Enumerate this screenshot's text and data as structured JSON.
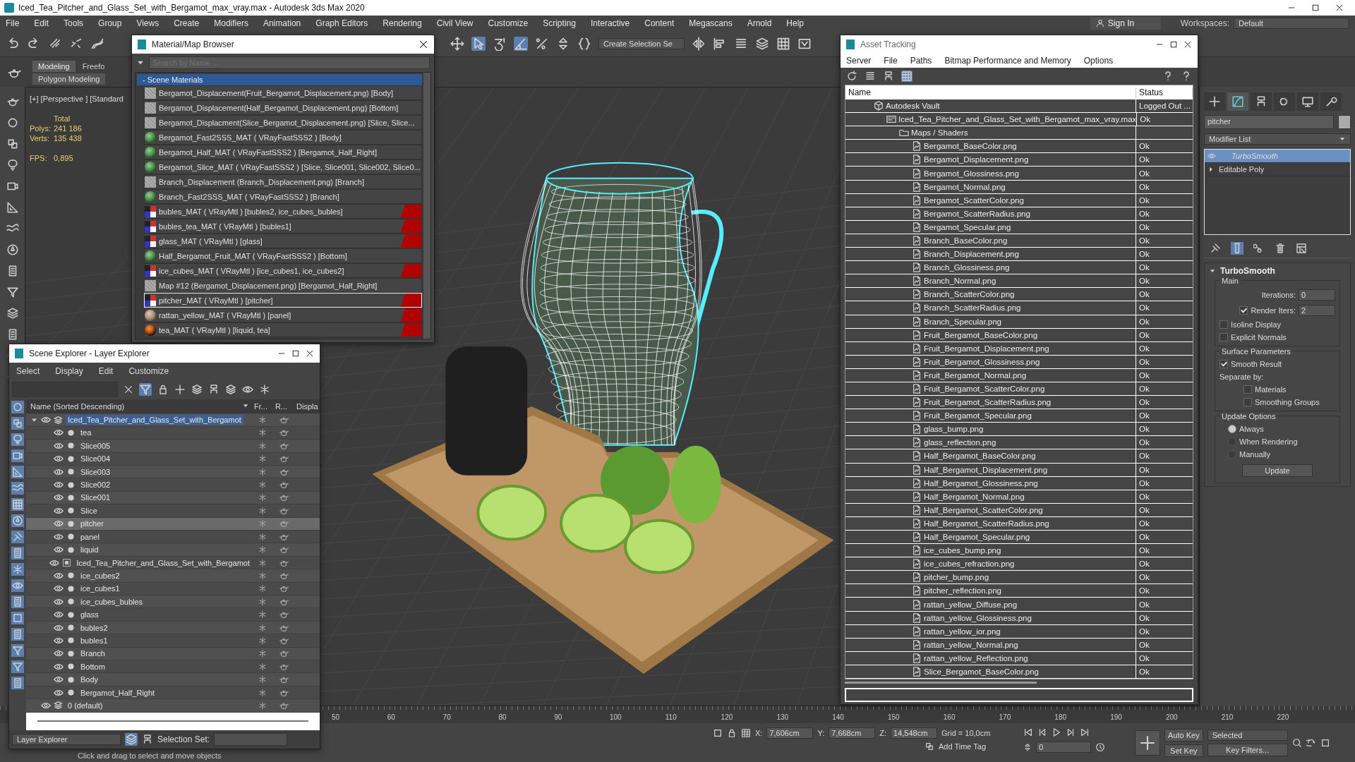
{
  "title": "Iced_Tea_Pitcher_and_Glass_Set_with_Bergamot_max_vray.max - Autodesk 3ds Max 2020",
  "menu": [
    "File",
    "Edit",
    "Tools",
    "Group",
    "Views",
    "Create",
    "Modifiers",
    "Animation",
    "Graph Editors",
    "Rendering",
    "Civil View",
    "Customize",
    "Scripting",
    "Interactive",
    "Content",
    "Megascans",
    "Arnold",
    "Help"
  ],
  "sign_in": "Sign In",
  "workspaces_label": "Workspaces:",
  "workspace": "Default",
  "selection_set_dropdown": "Create Selection Se",
  "ribbon": {
    "tabs": [
      {
        "label": "Modeling",
        "selected": true
      },
      {
        "label": "Freefo",
        "selected": false
      }
    ],
    "panel": "Polygon Modeling"
  },
  "viewport": {
    "label": "[+] [Perspective ] [Standard",
    "stats_header": "Total",
    "stats": [
      {
        "label": "Polys:",
        "value": "241 186"
      },
      {
        "label": "Verts:",
        "value": "135 438"
      }
    ],
    "fps_label": "FPS:",
    "fps": "0,895"
  },
  "material_browser": {
    "title": "Material/Map Browser",
    "search_placeholder": "Search by Name ...",
    "group": "- Scene Materials",
    "items": [
      {
        "text": "Bergamot_Displacement(Fruit_Bergamot_Displacement.png) [Body]",
        "kind": "map",
        "flagged": false,
        "selected": false
      },
      {
        "text": "Bergamot_Displacement(Half_Bergamot_Displacement.png) [Bottom]",
        "kind": "map",
        "flagged": false,
        "selected": false
      },
      {
        "text": "Bergamot_Displacment(Slice_Bergamot_Displacement.png) [Slice, Slice...",
        "kind": "map",
        "flagged": false,
        "selected": false
      },
      {
        "text": "Bergamot_Fast2SSS_MAT ( VRayFastSSS2 ) [Body]",
        "kind": "sss",
        "flagged": false,
        "selected": false
      },
      {
        "text": "Bergamot_Half_MAT ( VRayFastSSS2 ) [Bergamot_Half_Right]",
        "kind": "sss",
        "flagged": false,
        "selected": false
      },
      {
        "text": "Bergamot_Slice_MAT ( VRayFastSSS2 ) [Slice, Slice001, Slice002, Slice0...",
        "kind": "sss",
        "flagged": false,
        "selected": false
      },
      {
        "text": "Branch_Displacement (Branch_Displacement.png) [Branch]",
        "kind": "map",
        "flagged": false,
        "selected": false
      },
      {
        "text": "Branch_Fast2SSS_MAT ( VRayFastSSS2 ) [Branch]",
        "kind": "sss",
        "flagged": false,
        "selected": false
      },
      {
        "text": "bubles_MAT ( VRayMtl ) [bubles2, ice_cubes_bubles]",
        "kind": "vray",
        "flagged": true,
        "selected": false
      },
      {
        "text": "bubles_tea_MAT ( VRayMtl ) [bubles1]",
        "kind": "vray",
        "flagged": true,
        "selected": false
      },
      {
        "text": "glass_MAT ( VRayMtl ) [glass]",
        "kind": "vray",
        "flagged": true,
        "selected": false
      },
      {
        "text": "Half_Bergamot_Fruit_MAT ( VRayFastSSS2 ) [Bottom]",
        "kind": "sss",
        "flagged": false,
        "selected": false
      },
      {
        "text": "ice_cubes_MAT ( VRayMtl ) [ice_cubes1, ice_cubes2]",
        "kind": "vray",
        "flagged": true,
        "selected": false
      },
      {
        "text": "Map #12 (Bergamot_Displacement.png) [Bergamot_Half_Right]",
        "kind": "map",
        "flagged": false,
        "selected": false
      },
      {
        "text": "pitcher_MAT ( VRayMtl ) [pitcher]",
        "kind": "vray",
        "flagged": true,
        "selected": true
      },
      {
        "text": "rattan_yellow_MAT ( VRayMtl ) [panel]",
        "kind": "rattan",
        "flagged": true,
        "selected": false
      },
      {
        "text": "tea_MAT ( VRayMtl ) [liquid, tea]",
        "kind": "tea",
        "flagged": true,
        "selected": false
      }
    ]
  },
  "scene_explorer": {
    "title": "Scene Explorer - Layer Explorer",
    "menu": [
      "Select",
      "Display",
      "Edit",
      "Customize"
    ],
    "columns": [
      "Name (Sorted Descending)",
      "Fr...",
      "R...",
      "Displa"
    ],
    "layers": [
      {
        "name": "Iced_Tea_Pitcher_and_Glass_Set_with_Bergamot",
        "kind": "layer",
        "expanded": true,
        "selected": true,
        "children": [
          {
            "name": "tea",
            "kind": "object",
            "selected": false
          },
          {
            "name": "Slice005",
            "kind": "object",
            "selected": false
          },
          {
            "name": "Slice004",
            "kind": "object",
            "selected": false
          },
          {
            "name": "Slice003",
            "kind": "object",
            "selected": false
          },
          {
            "name": "Slice002",
            "kind": "object",
            "selected": false
          },
          {
            "name": "Slice001",
            "kind": "object",
            "selected": false
          },
          {
            "name": "Slice",
            "kind": "object",
            "selected": false
          },
          {
            "name": "pitcher",
            "kind": "object",
            "selected": true
          },
          {
            "name": "panel",
            "kind": "object",
            "selected": false
          },
          {
            "name": "liquid",
            "kind": "object",
            "selected": false
          },
          {
            "name": "Iced_Tea_Pitcher_and_Glass_Set_with_Bergamot",
            "kind": "container",
            "selected": false
          },
          {
            "name": "ice_cubes2",
            "kind": "object",
            "selected": false
          },
          {
            "name": "ice_cubes1",
            "kind": "object",
            "selected": false
          },
          {
            "name": "ice_cubes_bubles",
            "kind": "object",
            "selected": false
          },
          {
            "name": "glass",
            "kind": "object",
            "selected": false
          },
          {
            "name": "bubles2",
            "kind": "object",
            "selected": false
          },
          {
            "name": "bubles1",
            "kind": "object",
            "selected": false
          },
          {
            "name": "Branch",
            "kind": "object",
            "selected": false
          },
          {
            "name": "Bottom",
            "kind": "object",
            "selected": false
          },
          {
            "name": "Body",
            "kind": "object",
            "selected": false
          },
          {
            "name": "Bergamot_Half_Right",
            "kind": "object",
            "selected": false
          }
        ]
      },
      {
        "name": "0 (default)",
        "kind": "layer",
        "expanded": false,
        "selected": false
      }
    ],
    "footer_dropdown": "Layer Explorer",
    "selection_set_label": "Selection Set:"
  },
  "asset_tracking": {
    "title": "Asset Tracking",
    "menu": [
      "Server",
      "File",
      "Paths",
      "Bitmap Performance and Memory",
      "Options"
    ],
    "columns": [
      "Name",
      "Status"
    ],
    "assets": [
      {
        "name": "Autodesk Vault",
        "kind": "vault",
        "status": "Logged Out ...",
        "children": [
          {
            "name": "Iced_Tea_Pitcher_and_Glass_Set_with_Bergamot_max_vray.max",
            "kind": "scene",
            "status": "Ok",
            "children": [
              {
                "name": "Maps / Shaders",
                "kind": "folder",
                "children": [
                  {
                    "name": "Bergamot_BaseColor.png",
                    "kind": "bitmap",
                    "status": "Ok"
                  },
                  {
                    "name": "Bergamot_Displacement.png",
                    "kind": "bitmap",
                    "status": "Ok"
                  },
                  {
                    "name": "Bergamot_Glossiness.png",
                    "kind": "bitmap",
                    "status": "Ok"
                  },
                  {
                    "name": "Bergamot_Normal.png",
                    "kind": "bitmap",
                    "status": "Ok"
                  },
                  {
                    "name": "Bergamot_ScatterColor.png",
                    "kind": "bitmap",
                    "status": "Ok"
                  },
                  {
                    "name": "Bergamot_ScatterRadius.png",
                    "kind": "bitmap",
                    "status": "Ok"
                  },
                  {
                    "name": "Bergamot_Specular.png",
                    "kind": "bitmap",
                    "status": "Ok"
                  },
                  {
                    "name": "Branch_BaseColor.png",
                    "kind": "bitmap",
                    "status": "Ok"
                  },
                  {
                    "name": "Branch_Displacement.png",
                    "kind": "bitmap",
                    "status": "Ok"
                  },
                  {
                    "name": "Branch_Glossiness.png",
                    "kind": "bitmap",
                    "status": "Ok"
                  },
                  {
                    "name": "Branch_Normal.png",
                    "kind": "bitmap",
                    "status": "Ok"
                  },
                  {
                    "name": "Branch_ScatterColor.png",
                    "kind": "bitmap",
                    "status": "Ok"
                  },
                  {
                    "name": "Branch_ScatterRadius.png",
                    "kind": "bitmap",
                    "status": "Ok"
                  },
                  {
                    "name": "Branch_Specular.png",
                    "kind": "bitmap",
                    "status": "Ok"
                  },
                  {
                    "name": "Fruit_Bergamot_BaseColor.png",
                    "kind": "bitmap",
                    "status": "Ok"
                  },
                  {
                    "name": "Fruit_Bergamot_Displacement.png",
                    "kind": "bitmap",
                    "status": "Ok"
                  },
                  {
                    "name": "Fruit_Bergamot_Glossiness.png",
                    "kind": "bitmap",
                    "status": "Ok"
                  },
                  {
                    "name": "Fruit_Bergamot_Normal.png",
                    "kind": "bitmap",
                    "status": "Ok"
                  },
                  {
                    "name": "Fruit_Bergamot_ScatterColor.png",
                    "kind": "bitmap",
                    "status": "Ok"
                  },
                  {
                    "name": "Fruit_Bergamot_ScatterRadius.png",
                    "kind": "bitmap",
                    "status": "Ok"
                  },
                  {
                    "name": "Fruit_Bergamot_Specular.png",
                    "kind": "bitmap",
                    "status": "Ok"
                  },
                  {
                    "name": "glass_bump.png",
                    "kind": "bitmap",
                    "status": "Ok"
                  },
                  {
                    "name": "glass_reflection.png",
                    "kind": "bitmap",
                    "status": "Ok"
                  },
                  {
                    "name": "Half_Bergamot_BaseColor.png",
                    "kind": "bitmap",
                    "status": "Ok"
                  },
                  {
                    "name": "Half_Bergamot_Displacement.png",
                    "kind": "bitmap",
                    "status": "Ok"
                  },
                  {
                    "name": "Half_Bergamot_Glossiness.png",
                    "kind": "bitmap",
                    "status": "Ok"
                  },
                  {
                    "name": "Half_Bergamot_Normal.png",
                    "kind": "bitmap",
                    "status": "Ok"
                  },
                  {
                    "name": "Half_Bergamot_ScatterColor.png",
                    "kind": "bitmap",
                    "status": "Ok"
                  },
                  {
                    "name": "Half_Bergamot_ScatterRadius.png",
                    "kind": "bitmap",
                    "status": "Ok"
                  },
                  {
                    "name": "Half_Bergamot_Specular.png",
                    "kind": "bitmap",
                    "status": "Ok"
                  },
                  {
                    "name": "ice_cubes_bump.png",
                    "kind": "bitmap",
                    "status": "Ok"
                  },
                  {
                    "name": "ice_cubes_refraction.png",
                    "kind": "bitmap",
                    "status": "Ok"
                  },
                  {
                    "name": "pitcher_bump.png",
                    "kind": "bitmap",
                    "status": "Ok"
                  },
                  {
                    "name": "pitcher_reflection.png",
                    "kind": "bitmap",
                    "status": "Ok"
                  },
                  {
                    "name": "rattan_yellow_Diffuse.png",
                    "kind": "bitmap",
                    "status": "Ok"
                  },
                  {
                    "name": "rattan_yellow_Glossiness.png",
                    "kind": "bitmap",
                    "status": "Ok"
                  },
                  {
                    "name": "rattan_yellow_ior.png",
                    "kind": "bitmap",
                    "status": "Ok"
                  },
                  {
                    "name": "rattan_yellow_Normal.png",
                    "kind": "bitmap",
                    "status": "Ok"
                  },
                  {
                    "name": "rattan_yellow_Reflection.png",
                    "kind": "bitmap",
                    "status": "Ok"
                  },
                  {
                    "name": "Slice_Bergamot_BaseColor.png",
                    "kind": "bitmap",
                    "status": "Ok"
                  }
                ]
              }
            ]
          }
        ]
      }
    ]
  },
  "command_panel": {
    "tabs": [
      {
        "kind": "create",
        "selected": false
      },
      {
        "kind": "modify",
        "selected": true
      },
      {
        "kind": "hierarchy",
        "selected": false
      },
      {
        "kind": "motion",
        "selected": false
      },
      {
        "kind": "display",
        "selected": false
      },
      {
        "kind": "utilities",
        "selected": false
      }
    ],
    "object_name": "pitcher",
    "modifier_list": "Modifier List",
    "stack": [
      {
        "label": "TurboSmooth",
        "kind": "modifier",
        "selected": true
      },
      {
        "label": "Editable Poly",
        "kind": "base",
        "selected": false
      }
    ],
    "rollout": {
      "title": "TurboSmooth",
      "groups": [
        {
          "title": "Main",
          "controls": [
            {
              "kind": "spinner",
              "label": "Iterations:",
              "value": "0"
            },
            {
              "kind": "check_spinner",
              "label": "Render Iters:",
              "value": "2",
              "checked": true
            },
            {
              "kind": "checkbox",
              "label": "Isoline Display",
              "checked": false
            },
            {
              "kind": "checkbox",
              "label": "Explicit Normals",
              "checked": false
            }
          ]
        },
        {
          "title": "Surface Parameters",
          "controls": [
            {
              "kind": "checkbox",
              "label": "Smooth Result",
              "checked": true
            },
            {
              "kind": "label",
              "label": "Separate by:"
            },
            {
              "kind": "subcheckbox",
              "label": "Materials",
              "checked": false
            },
            {
              "kind": "subcheckbox",
              "label": "Smoothing Groups",
              "checked": false
            }
          ]
        },
        {
          "title": "Update Options",
          "controls": [
            {
              "kind": "radio",
              "label": "Always",
              "selected": true
            },
            {
              "kind": "radio",
              "label": "When Rendering",
              "selected": false
            },
            {
              "kind": "radio",
              "label": "Manually",
              "selected": false
            },
            {
              "kind": "button",
              "label": "Update"
            }
          ]
        }
      ]
    }
  },
  "timeline": {
    "ticks": [
      "50",
      "60",
      "70",
      "80",
      "90",
      "100",
      "110",
      "120",
      "130",
      "140",
      "150",
      "160",
      "170",
      "180",
      "190",
      "200",
      "210",
      "220"
    ]
  },
  "status": {
    "prompt": "Click and drag to select and move objects",
    "coords": [
      {
        "label": "X:",
        "value": "7,606cm"
      },
      {
        "label": "Y:",
        "value": "7,668cm"
      },
      {
        "label": "Z:",
        "value": "14,548cm"
      }
    ],
    "grid": "Grid = 10,0cm",
    "time_tag": "Add Time Tag",
    "auto_key": "Auto Key",
    "key_mode": "Selected",
    "set_key": "Set Key",
    "key_filters": "Key Filters...",
    "frame": "0"
  }
}
